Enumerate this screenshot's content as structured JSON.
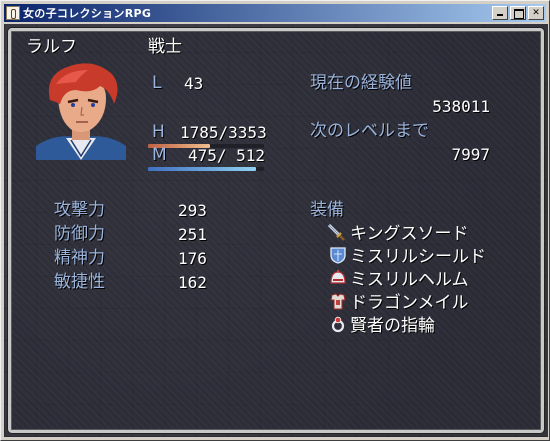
{
  "window": {
    "title": "女の子コレクションRPG"
  },
  "actor": {
    "name": "ラルフ",
    "class": "戦士",
    "level_label": "L",
    "level": "43",
    "hp_label": "H",
    "hp": "1785/3353",
    "hp_fraction": 0.532,
    "mp_label": "M",
    "mp": "475/ 512",
    "mp_fraction": 0.928
  },
  "exp": {
    "current_label": "現在の経験値",
    "current_value": "538011",
    "next_label": "次のレベルまで",
    "next_value": "7997"
  },
  "params": [
    {
      "label": "攻撃力",
      "value": "293"
    },
    {
      "label": "防御力",
      "value": "251"
    },
    {
      "label": "精神力",
      "value": "176"
    },
    {
      "label": "敏捷性",
      "value": "162"
    }
  ],
  "equipment": {
    "title": "装備",
    "items": [
      {
        "name": "キングスソード",
        "icon": "sword-icon"
      },
      {
        "name": "ミスリルシールド",
        "icon": "shield-icon"
      },
      {
        "name": "ミスリルヘルム",
        "icon": "helmet-icon"
      },
      {
        "name": "ドラゴンメイル",
        "icon": "armor-icon"
      },
      {
        "name": "賢者の指輪",
        "icon": "ring-icon"
      }
    ]
  },
  "colors": {
    "system_text": "#9bb4dc",
    "hp_gauge": "#e0a070",
    "mp_gauge": "#70b0e0"
  }
}
